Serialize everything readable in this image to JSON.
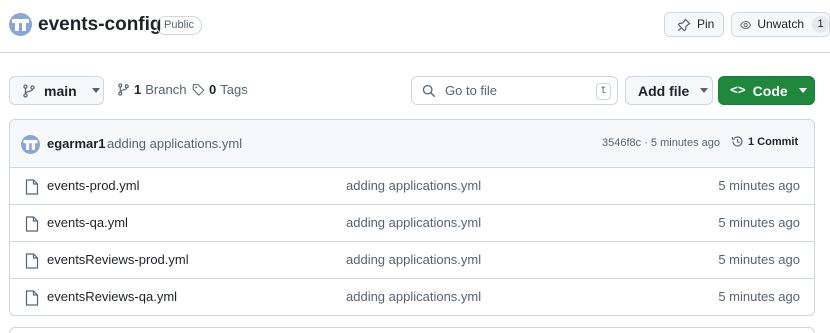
{
  "repo": {
    "name": "events-config",
    "visibility": "Public"
  },
  "header_actions": {
    "pin_label": "Pin",
    "watch_label": "Unwatch",
    "watch_count": "1"
  },
  "toolbar": {
    "branch": "main",
    "branches_count": "1",
    "branches_label": "Branch",
    "tags_count": "0",
    "tags_label": "Tags",
    "search_placeholder": "Go to file",
    "search_shortcut": "t",
    "add_file_label": "Add file",
    "code_label": "Code"
  },
  "latest_commit": {
    "author": "egarmar1",
    "message": "adding applications.yml",
    "sha_time": "3546f8c · 5 minutes ago",
    "commits_label": "1 Commit"
  },
  "files": [
    {
      "name": "events-prod.yml",
      "message": "adding applications.yml",
      "time": "5 minutes ago"
    },
    {
      "name": "events-qa.yml",
      "message": "adding applications.yml",
      "time": "5 minutes ago"
    },
    {
      "name": "eventsReviews-prod.yml",
      "message": "adding applications.yml",
      "time": "5 minutes ago"
    },
    {
      "name": "eventsReviews-qa.yml",
      "message": "adding applications.yml",
      "time": "5 minutes ago"
    }
  ],
  "icons": {
    "avatar": "identicon",
    "pin": "pin-icon",
    "watch": "eye-icon",
    "branch": "git-branch-icon",
    "tag": "tag-icon",
    "search": "search-icon",
    "history": "history-icon",
    "file": "file-icon"
  },
  "colors": {
    "accent_green": "#1f883d",
    "border": "#d0d7de",
    "muted_text": "#59636e",
    "avatar_blue": "#8aa5d6"
  }
}
